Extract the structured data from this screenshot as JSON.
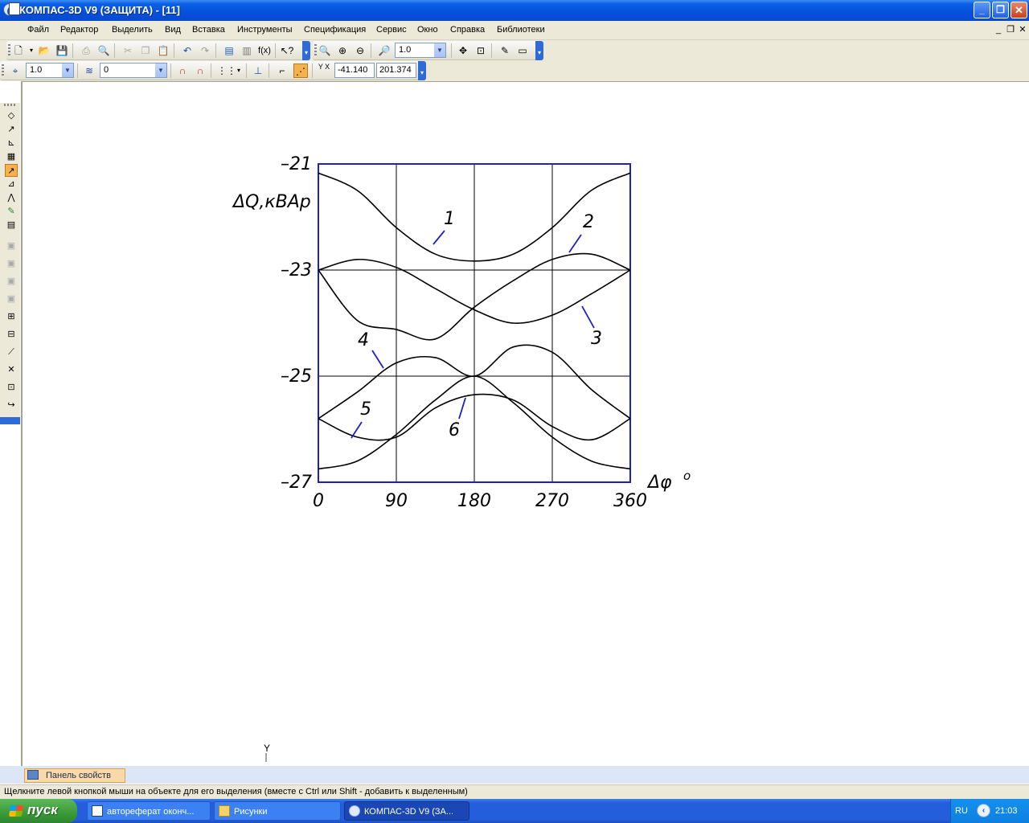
{
  "window": {
    "title": "КОМПАС-3D V9 (ЗАЩИТА) - [11]",
    "minimize": "_",
    "restore": "❐",
    "close": "✕"
  },
  "menu": {
    "items": [
      "Файл",
      "Редактор",
      "Выделить",
      "Вид",
      "Вставка",
      "Инструменты",
      "Спецификация",
      "Сервис",
      "Окно",
      "Справка",
      "Библиотеки"
    ],
    "doc_min": "_",
    "doc_restore": "❐",
    "doc_close": "✕"
  },
  "toolbar1": {
    "zoom_value": "1.0"
  },
  "toolbar2": {
    "step_value": "1.0",
    "layer_value": "0",
    "coord_label": "Y X",
    "coord_x": "-41.140",
    "coord_y": "201.374"
  },
  "canvas": {
    "axis_marker": "Y"
  },
  "property_panel": {
    "label": "Панель свойств"
  },
  "status": {
    "text": "Щелкните левой кнопкой мыши на объекте для его выделения (вместе с Ctrl или Shift - добавить к выделенным)"
  },
  "taskbar": {
    "start": "пуск",
    "tasks": [
      {
        "label": "автореферат оконч...",
        "icon": "word-icon"
      },
      {
        "label": "Рисунки",
        "icon": "folder-icon"
      },
      {
        "label": "КОМПАС-3D V9 (ЗА...",
        "icon": "kompas-icon"
      }
    ],
    "lang": "RU",
    "clock": "21:03"
  },
  "chart_data": {
    "type": "line",
    "ylabel": "ΔQ,кВАр",
    "xlabel": "Δφ",
    "xlabel_superscript": "o",
    "xlim": [
      0,
      360
    ],
    "ylim": [
      -27,
      -21
    ],
    "xticks": [
      "0",
      "90",
      "180",
      "270",
      "360"
    ],
    "yticks": [
      "–21",
      "–23",
      "–25",
      "–27"
    ],
    "ytick_values": [
      -21,
      -23,
      -25,
      -27
    ],
    "grid": true,
    "series": [
      {
        "name": "1",
        "x": [
          0,
          45,
          90,
          135,
          180,
          225,
          270,
          315,
          360
        ],
        "y": [
          -21.17,
          -21.5,
          -22.2,
          -22.7,
          -22.83,
          -22.7,
          -22.2,
          -21.5,
          -21.17
        ]
      },
      {
        "name": "2",
        "x": [
          0,
          45,
          90,
          135,
          180,
          225,
          270,
          315,
          360
        ],
        "y": [
          -23,
          -23.95,
          -24.12,
          -24.3,
          -23.7,
          -23.2,
          -22.8,
          -22.7,
          -23
        ]
      },
      {
        "name": "3",
        "x": [
          0,
          45,
          90,
          135,
          180,
          225,
          270,
          315,
          360
        ],
        "y": [
          -23,
          -22.8,
          -22.95,
          -23.35,
          -23.75,
          -24.0,
          -23.85,
          -23.45,
          -23
        ]
      },
      {
        "name": "4",
        "x": [
          0,
          45,
          90,
          135,
          180,
          225,
          270,
          315,
          360
        ],
        "y": [
          -25.8,
          -25.3,
          -24.75,
          -24.65,
          -25.0,
          -24.45,
          -24.55,
          -25.25,
          -25.8
        ]
      },
      {
        "name": "5",
        "x": [
          0,
          45,
          90,
          135,
          180,
          225,
          270,
          315,
          360
        ],
        "y": [
          -25.8,
          -26.15,
          -26.15,
          -25.6,
          -25.35,
          -25.45,
          -25.95,
          -26.2,
          -25.8
        ]
      },
      {
        "name": "6",
        "x": [
          0,
          45,
          90,
          135,
          180,
          225,
          270,
          315,
          360
        ],
        "y": [
          -26.75,
          -26.6,
          -26.1,
          -25.45,
          -25.0,
          -25.5,
          -26.15,
          -26.6,
          -26.75
        ]
      }
    ]
  }
}
